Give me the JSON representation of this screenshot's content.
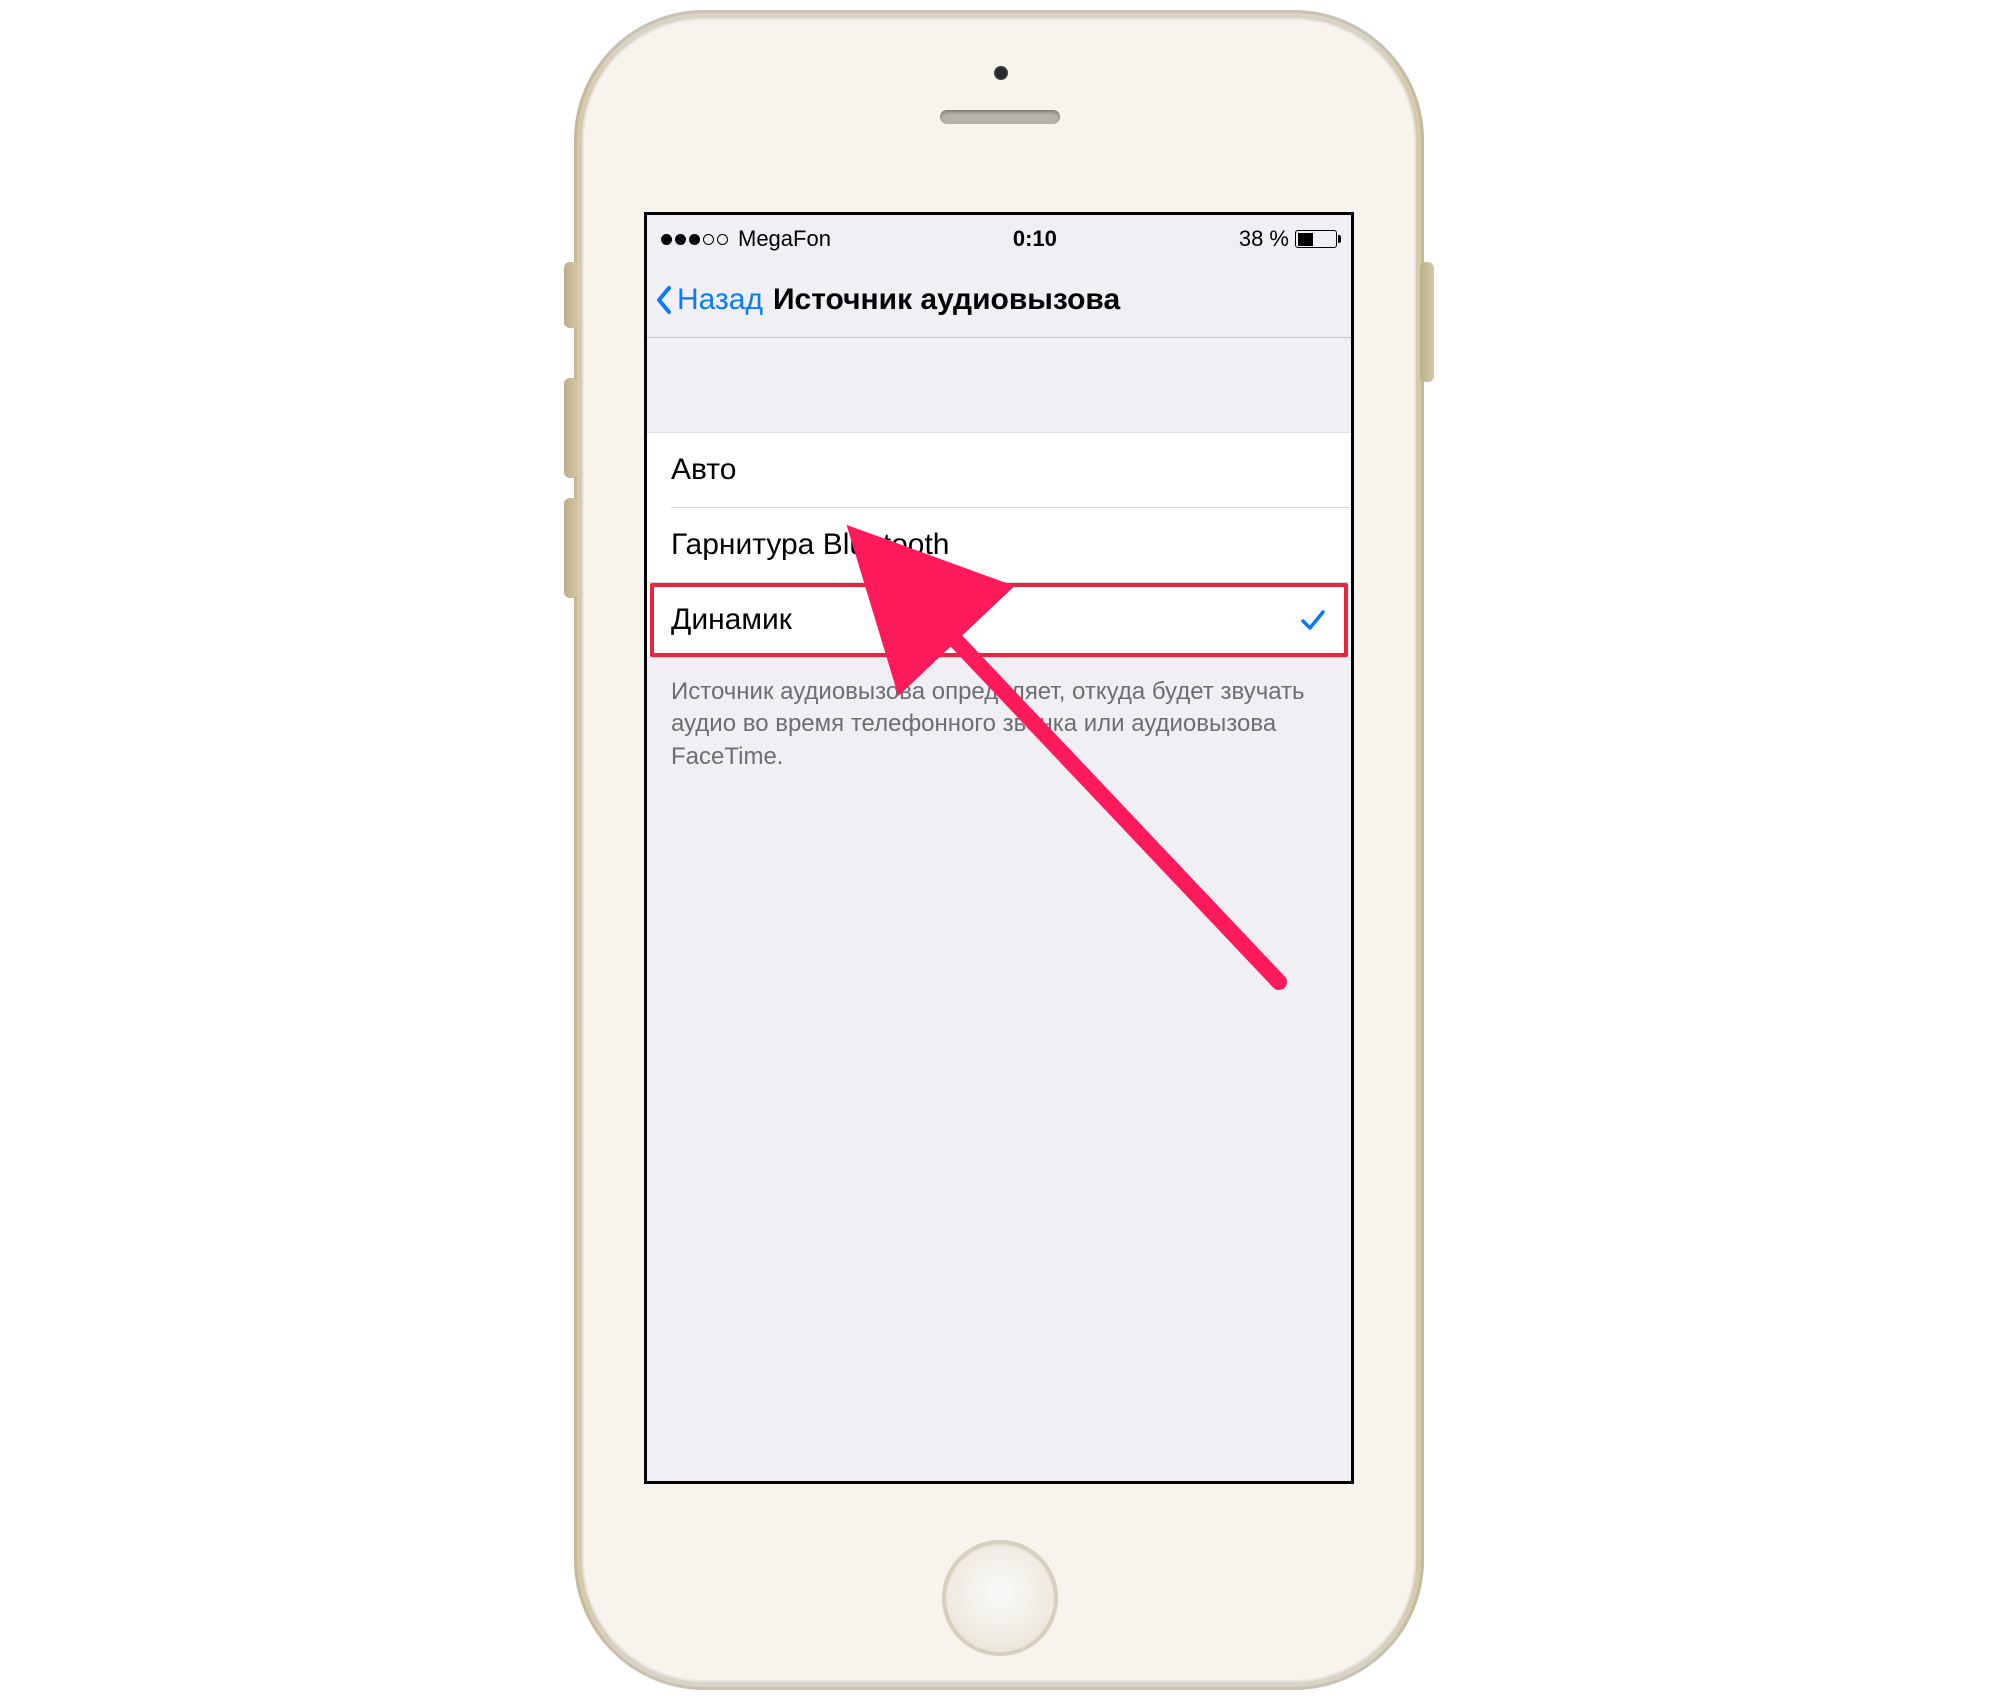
{
  "status": {
    "carrier": "MegaFon",
    "time": "0:10",
    "battery_pct": "38 %",
    "signal_filled": 3,
    "signal_total": 5
  },
  "nav": {
    "back_label": "Назад",
    "title": "Источник аудиовызова"
  },
  "options": {
    "auto": "Авто",
    "bt": "Гарнитура Bluetooth",
    "speaker": "Динамик"
  },
  "selected": "speaker",
  "footer": "Источник аудиовызова определяет, откуда будет звучать аудио во время телефонного звонка или аудиовызова FaceTime."
}
